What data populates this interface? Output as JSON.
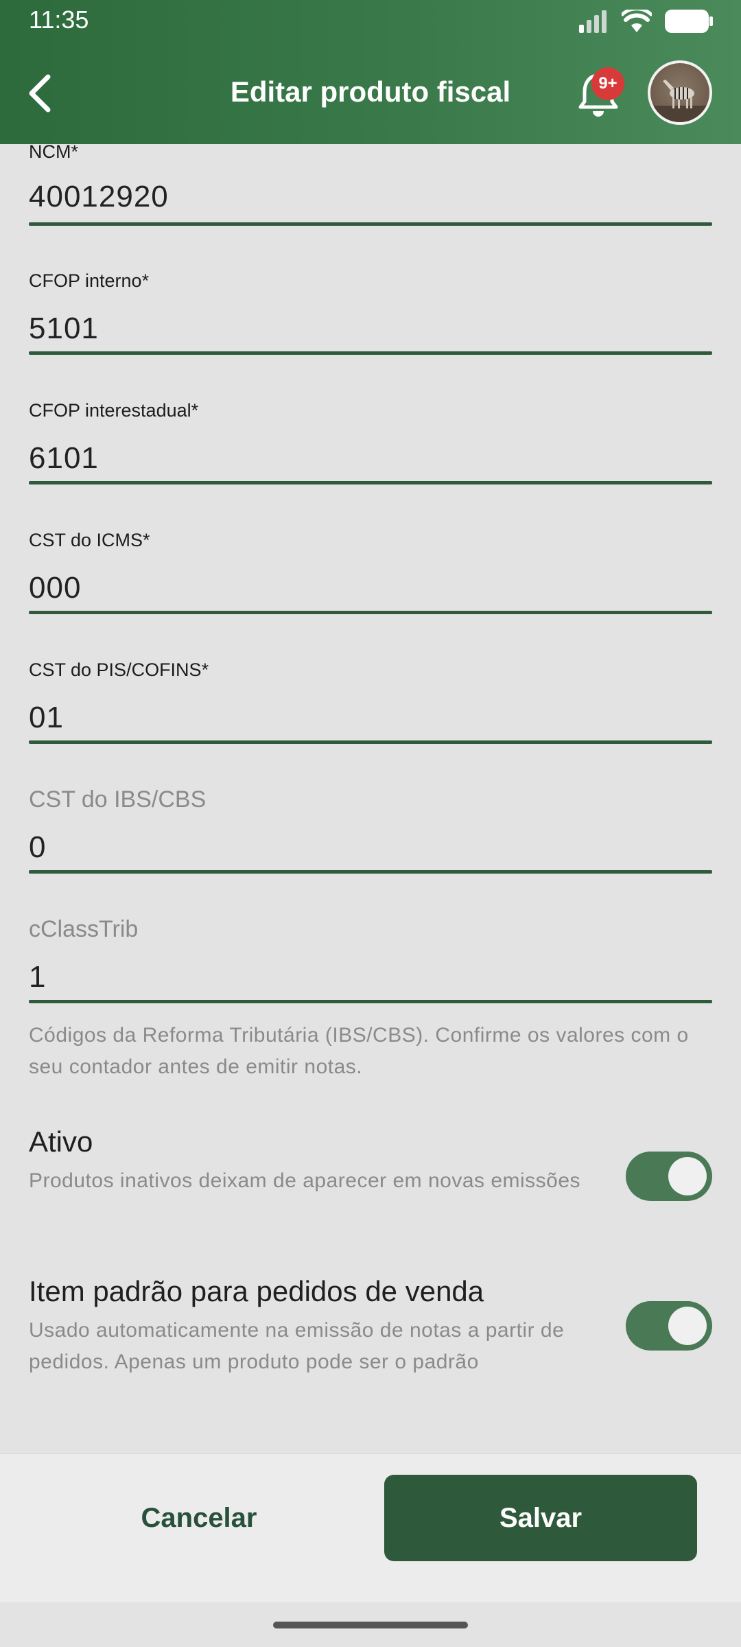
{
  "status_bar": {
    "time": "11:35"
  },
  "header": {
    "title": "Editar produto fiscal",
    "notification_badge": "9+"
  },
  "fields": [
    {
      "label": "NCM*",
      "value": "40012920"
    },
    {
      "label": "CFOP interno*",
      "value": "5101"
    },
    {
      "label": "CFOP interestadual*",
      "value": "6101"
    },
    {
      "label": "CST do ICMS*",
      "value": "000"
    },
    {
      "label": "CST do PIS/COFINS*",
      "value": "01"
    },
    {
      "label": "CST do IBS/CBS",
      "value": "0"
    },
    {
      "label": "cClassTrib",
      "value": "1"
    }
  ],
  "helper_text": "Códigos da Reforma Tributária (IBS/CBS). Confirme os valores com o seu contador antes de emitir notas.",
  "toggles": [
    {
      "title": "Ativo",
      "description": "Produtos inativos deixam de aparecer em novas emissões",
      "on": true
    },
    {
      "title": "Item padrão para pedidos de venda",
      "description": "Usado automaticamente na emissão de notas a partir de pedidos. Apenas um produto pode ser o padrão",
      "on": true
    }
  ],
  "actions": {
    "cancel_label": "Cancelar",
    "save_label": "Salvar"
  },
  "colors": {
    "header": "#2d6a3c",
    "accent": "#2e5a3b",
    "badge": "#d83a3a"
  }
}
